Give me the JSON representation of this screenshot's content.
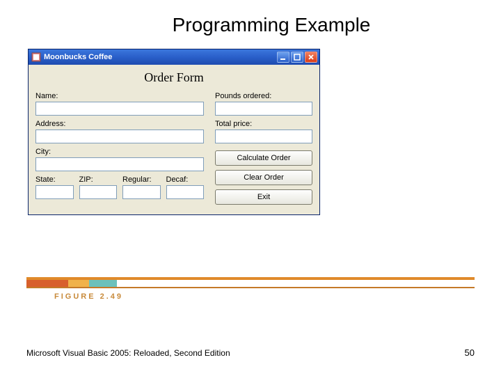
{
  "slide": {
    "title": "Programming Example",
    "figure_label": "FIGURE 2.49",
    "footer_text": "Microsoft Visual Basic 2005: Reloaded, Second Edition",
    "page_number": "50"
  },
  "window": {
    "title": "Moonbucks Coffee",
    "form_title": "Order Form",
    "left_fields": {
      "name_label": "Name:",
      "address_label": "Address:",
      "city_label": "City:",
      "state_label": "State:",
      "zip_label": "ZIP:",
      "regular_label": "Regular:",
      "decaf_label": "Decaf:",
      "name_value": "",
      "address_value": "",
      "city_value": "",
      "state_value": "",
      "zip_value": "",
      "regular_value": "",
      "decaf_value": ""
    },
    "right_fields": {
      "pounds_label": "Pounds ordered:",
      "total_label": "Total price:",
      "pounds_value": "",
      "total_value": ""
    },
    "buttons": {
      "calculate": "Calculate Order",
      "clear": "Clear Order",
      "exit": "Exit"
    }
  }
}
